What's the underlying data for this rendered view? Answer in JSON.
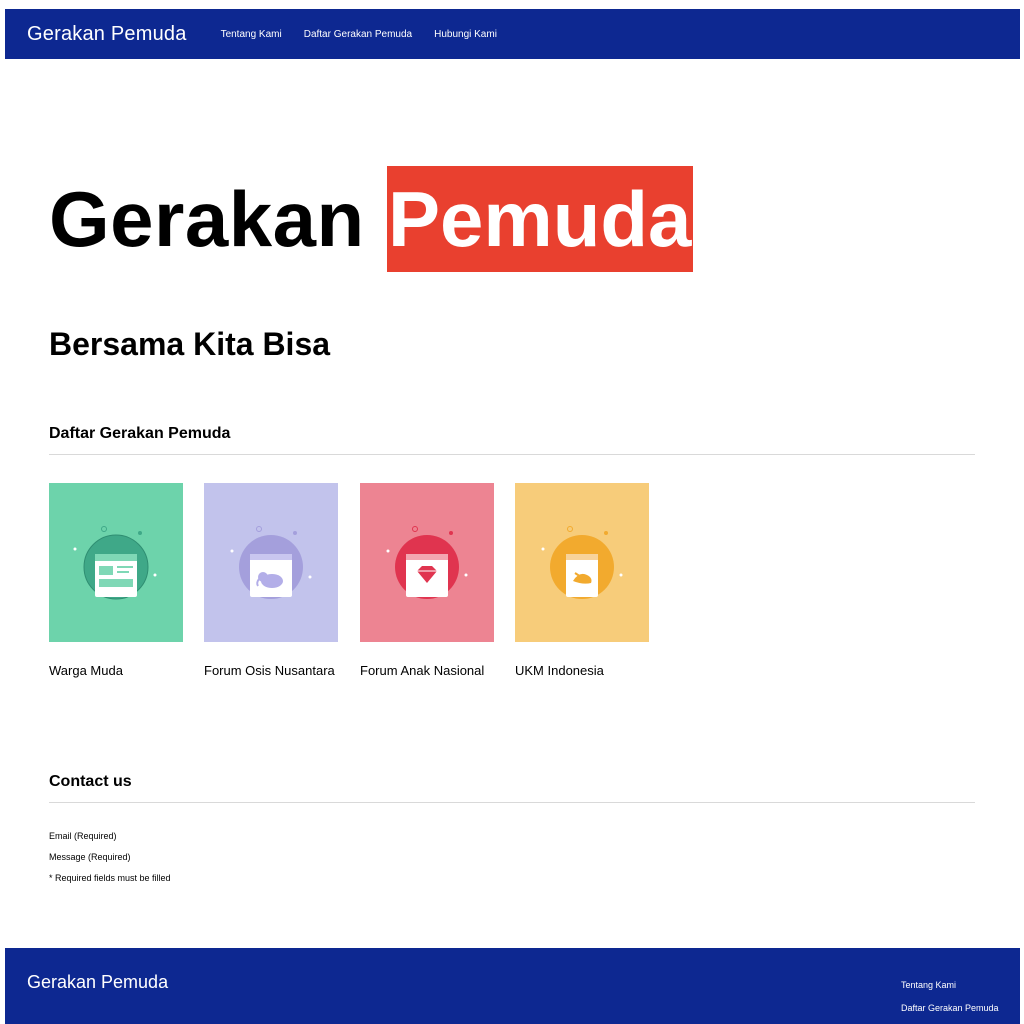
{
  "header": {
    "brand": "Gerakan Pemuda",
    "nav": [
      "Tentang Kami",
      "Daftar Gerakan Pemuda",
      "Hubungi Kami"
    ]
  },
  "hero": {
    "title_plain": "Gerakan",
    "title_highlight": "Pemuda",
    "highlight_color": "#e9402f",
    "tagline": "Bersama Kita Bisa"
  },
  "movements": {
    "title": "Daftar Gerakan Pemuda",
    "items": [
      {
        "label": "Warga Muda",
        "color": "#6dd3ab",
        "icon": "browser-window-icon"
      },
      {
        "label": "Forum Osis Nusantara",
        "color": "#c2c3ec",
        "icon": "elephant-icon"
      },
      {
        "label": "Forum Anak Nasional",
        "color": "#ed8492",
        "icon": "diamond-icon"
      },
      {
        "label": "UKM Indonesia",
        "color": "#f7cc7a",
        "icon": "hand-icon"
      }
    ]
  },
  "contact": {
    "title": "Contact us",
    "email_label": "Email (Required)",
    "message_label": "Message (Required)",
    "note": "* Required fields must be filled"
  },
  "footer": {
    "brand": "Gerakan Pemuda",
    "links": [
      "Tentang Kami",
      "Daftar Gerakan Pemuda"
    ]
  },
  "colors": {
    "nav_bg": "#0d2891"
  }
}
